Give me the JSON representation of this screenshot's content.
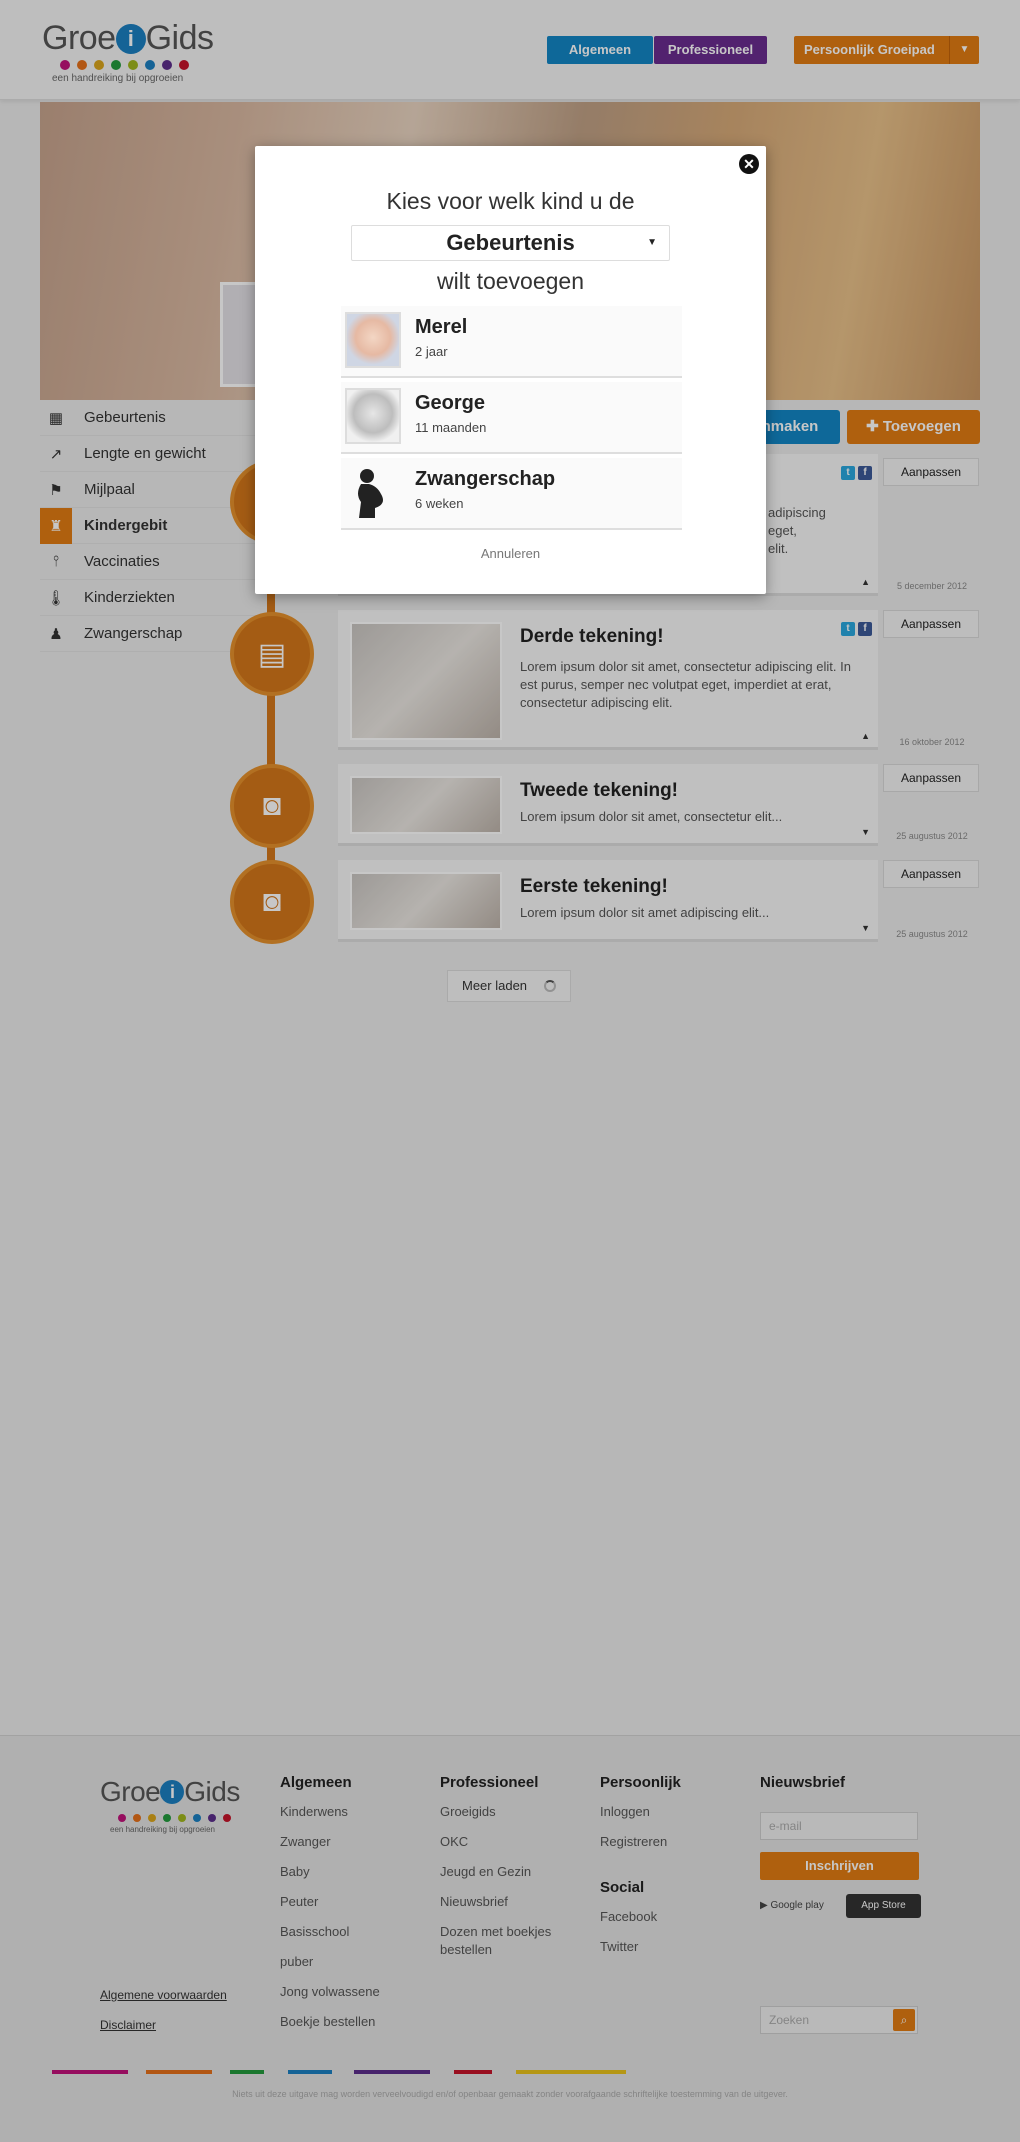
{
  "header": {
    "logo_prefix": "Groe",
    "logo_i": "i",
    "logo_suffix": "Gids",
    "logo_tagline": "een handreiking bij opgroeien",
    "logo_dot_colors": [
      "#c0137a",
      "#e5701a",
      "#d9a41c",
      "#239a3d",
      "#9fb51d",
      "#1b7fc1",
      "#5b2d8b",
      "#c4142a"
    ],
    "nav": {
      "algemeen": "Algemeen",
      "professioneel": "Professioneel",
      "persoonlijk": "Persoonlijk Groeipad"
    }
  },
  "sidebar": {
    "items": [
      {
        "label": "Gebeurtenis",
        "icon": "calendar-icon"
      },
      {
        "label": "Lengte en gewicht",
        "icon": "chart-icon"
      },
      {
        "label": "Mijlpaal",
        "icon": "flag-icon"
      },
      {
        "label": "Kindergebit",
        "icon": "tooth-icon",
        "active": true
      },
      {
        "label": "Vaccinaties",
        "icon": "syringe-icon"
      },
      {
        "label": "Kinderziekten",
        "icon": "thermometer-icon"
      },
      {
        "label": "Zwangerschap",
        "icon": "pregnant-icon"
      }
    ]
  },
  "actions": {
    "blue_button": "nmaken",
    "add_button": "Toevoegen"
  },
  "timeline": {
    "aanpassen": "Aanpassen",
    "cards": [
      {
        "title": "",
        "desc_partial": "adipiscing\neget,\nelit.",
        "date": "5 december 2012"
      },
      {
        "title": "Derde tekening!",
        "desc": "Lorem ipsum dolor sit amet, consectetur adipiscing elit. In est purus, semper nec volutpat eget, imperdiet at erat, consectetur adipiscing elit.",
        "date": "16 oktober 2012"
      },
      {
        "title": "Tweede tekening!",
        "desc": "Lorem ipsum dolor sit amet, consectetur elit...",
        "date": "25 augustus 2012"
      },
      {
        "title": "Eerste tekening!",
        "desc": "Lorem ipsum dolor sit amet adipiscing elit...",
        "date": "25 augustus 2012"
      }
    ],
    "load_more": "Meer laden"
  },
  "modal": {
    "line1": "Kies voor welk kind u de",
    "select_value": "Gebeurtenis",
    "line2": "wilt toevoegen",
    "children": [
      {
        "name": "Merel",
        "age": "2 jaar"
      },
      {
        "name": "George",
        "age": "11 maanden"
      },
      {
        "name": "Zwangerschap",
        "age": "6 weken"
      }
    ],
    "cancel": "Annuleren",
    "close_glyph": "✕"
  },
  "footer": {
    "columns": {
      "algemeen": {
        "title": "Algemeen",
        "links": [
          "Kinderwens",
          "Zwanger",
          "Baby",
          "Peuter",
          "Basisschool",
          "puber",
          "Jong volwassene",
          "Boekje bestellen"
        ]
      },
      "professioneel": {
        "title": "Professioneel",
        "links": [
          "Groeigids",
          "OKC",
          "Jeugd en Gezin",
          "Nieuwsbrief",
          "Dozen met boekjes bestellen"
        ]
      },
      "persoonlijk": {
        "title": "Persoonlijk",
        "links": [
          "Inloggen",
          "Registreren"
        ]
      },
      "social": {
        "title": "Social",
        "links": [
          "Facebook",
          "Twitter"
        ]
      }
    },
    "newsletter": {
      "title": "Nieuwsbrief",
      "email_placeholder": "e-mail",
      "subscribe": "Inschrijven",
      "google_play": "Google play",
      "app_store": "App Store"
    },
    "terms": "Algemene voorwaarden",
    "disclaimer": "Disclaimer",
    "search_placeholder": "Zoeken",
    "copyright": "Niets uit deze uitgave mag worden verveelvoudigd en/of openbaar gemaakt zonder voorafgaande schriftelijke toestemming van de uitgever.",
    "bar_colors": [
      "#c0137a",
      "#e5701a",
      "#239a3d",
      "#1b7fc1",
      "#5b2d8b",
      "#c4142a",
      "#e8c21b"
    ]
  }
}
